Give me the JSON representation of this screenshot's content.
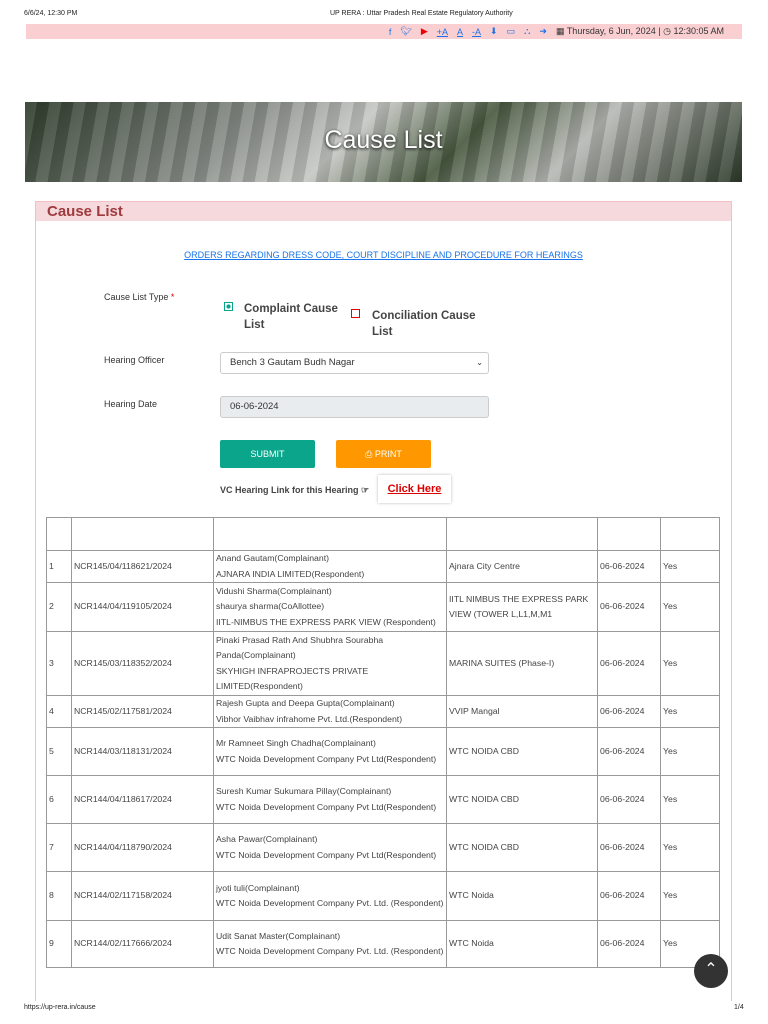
{
  "print_header": {
    "datetime": "6/6/24, 12:30 PM",
    "title": "UP RERA : Uttar Pradesh Real Estate Regulatory Authority"
  },
  "topbar": {
    "font_increase": "+A",
    "font_normal": "A",
    "font_decrease": "-A",
    "date": "Thursday, 6 Jun, 2024",
    "time": "12:30:05 AM",
    "separator": "|"
  },
  "banner": {
    "title": "Cause List"
  },
  "panel": {
    "title": "Cause List"
  },
  "form": {
    "orders_link": "ORDERS REGARDING DRESS CODE, COURT DISCIPLINE AND PROCEDURE FOR HEARINGS",
    "cause_list_type_label": "Cause List Type",
    "required": "*",
    "option_complaint": "Complaint Cause List",
    "option_conciliation": "Conciliation Cause List",
    "hearing_officer_label": "Hearing Officer",
    "hearing_officer_value": "Bench 3 Gautam Budh Nagar",
    "hearing_date_label": "Hearing Date",
    "hearing_date_value": "06-06-2024",
    "submit": "SUBMIT",
    "print": "PRINT",
    "vc_label": "VC Hearing Link for this Hearing",
    "click_here": "Click Here"
  },
  "colors": {
    "accent": "#0aa58a",
    "print": "#ff9800",
    "header_pink": "#f9cfd2"
  },
  "table": {
    "rows": [
      [
        "1",
        "NCR145/04/118621/2024",
        "Anand Gautam(Complainant)\nAJNARA INDIA LIMITED(Respondent)",
        "Ajnara City Centre",
        "06-06-2024",
        "Yes"
      ],
      [
        "2",
        "NCR144/04/119105/2024",
        "Vidushi Sharma(Complainant)\nshaurya sharma(CoAllottee)\nIITL-NIMBUS THE EXPRESS PARK VIEW (Respondent)",
        "IITL NIMBUS THE EXPRESS PARK VIEW (TOWER L,L1,M,M1",
        "06-06-2024",
        "Yes"
      ],
      [
        "3",
        "NCR145/03/118352/2024",
        "Pinaki Prasad Rath And Shubhra Sourabha Panda(Complainant)\nSKYHIGH INFRAPROJECTS PRIVATE LIMITED(Respondent)",
        "MARINA SUITES (Phase-I)",
        "06-06-2024",
        "Yes"
      ],
      [
        "4",
        "NCR145/02/117581/2024",
        "Rajesh Gupta and Deepa Gupta(Complainant)\nVibhor Vaibhav infrahome Pvt. Ltd.(Respondent)",
        "VVIP Mangal",
        "06-06-2024",
        "Yes"
      ],
      [
        "5",
        "NCR144/03/118131/2024",
        "Mr Ramneet Singh Chadha(Complainant)\nWTC Noida Development Company Pvt Ltd(Respondent)",
        "WTC NOIDA CBD",
        "06-06-2024",
        "Yes"
      ],
      [
        "6",
        "NCR144/04/118617/2024",
        "Suresh Kumar Sukumara Pillay(Complainant)\nWTC Noida Development Company Pvt Ltd(Respondent)",
        "WTC NOIDA CBD",
        "06-06-2024",
        "Yes"
      ],
      [
        "7",
        "NCR144/04/118790/2024",
        "Asha Pawar(Complainant)\nWTC Noida Development Company Pvt Ltd(Respondent)",
        "WTC NOIDA CBD",
        "06-06-2024",
        "Yes"
      ],
      [
        "8",
        "NCR144/02/117158/2024",
        "jyoti tuli(Complainant)\nWTC Noida Development Company Pvt. Ltd. (Respondent)",
        "WTC Noida",
        "06-06-2024",
        "Yes"
      ],
      [
        "9",
        "NCR144/02/117666/2024",
        "Udit Sanat Master(Complainant)\nWTC Noida Development Company Pvt. Ltd. (Respondent)",
        "WTC Noida",
        "06-06-2024",
        "Yes"
      ]
    ]
  },
  "footer": {
    "url": "https://up-rera.in/cause",
    "page": "1/4"
  }
}
